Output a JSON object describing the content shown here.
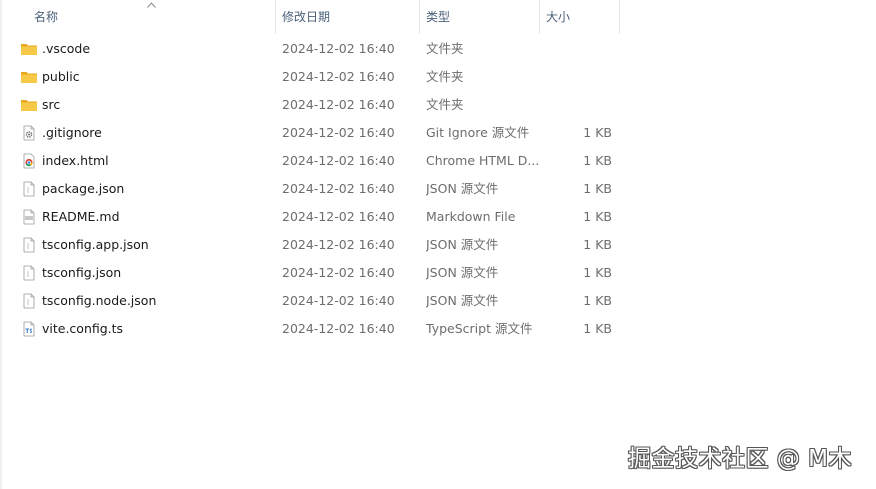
{
  "columns": {
    "name": "名称",
    "date": "修改日期",
    "type": "类型",
    "size": "大小"
  },
  "files": [
    {
      "name": ".vscode",
      "date": "2024-12-02 16:40",
      "type": "文件夹",
      "size": "",
      "icon": "folder-icon"
    },
    {
      "name": "public",
      "date": "2024-12-02 16:40",
      "type": "文件夹",
      "size": "",
      "icon": "folder-icon"
    },
    {
      "name": "src",
      "date": "2024-12-02 16:40",
      "type": "文件夹",
      "size": "",
      "icon": "folder-icon"
    },
    {
      "name": ".gitignore",
      "date": "2024-12-02 16:40",
      "type": "Git Ignore 源文件",
      "size": "1 KB",
      "icon": "gear-file-icon"
    },
    {
      "name": "index.html",
      "date": "2024-12-02 16:40",
      "type": "Chrome HTML D...",
      "size": "1 KB",
      "icon": "chrome-file-icon"
    },
    {
      "name": "package.json",
      "date": "2024-12-02 16:40",
      "type": "JSON 源文件",
      "size": "1 KB",
      "icon": "text-file-icon"
    },
    {
      "name": "README.md",
      "date": "2024-12-02 16:40",
      "type": "Markdown File",
      "size": "1 KB",
      "icon": "markdown-file-icon"
    },
    {
      "name": "tsconfig.app.json",
      "date": "2024-12-02 16:40",
      "type": "JSON 源文件",
      "size": "1 KB",
      "icon": "text-file-icon"
    },
    {
      "name": "tsconfig.json",
      "date": "2024-12-02 16:40",
      "type": "JSON 源文件",
      "size": "1 KB",
      "icon": "text-file-icon"
    },
    {
      "name": "tsconfig.node.json",
      "date": "2024-12-02 16:40",
      "type": "JSON 源文件",
      "size": "1 KB",
      "icon": "text-file-icon"
    },
    {
      "name": "vite.config.ts",
      "date": "2024-12-02 16:40",
      "type": "TypeScript 源文件",
      "size": "1 KB",
      "icon": "typescript-file-icon"
    }
  ],
  "watermark": "掘金技术社区 @ M木",
  "colors": {
    "header_text": "#4c607a",
    "folder": "#f5c342",
    "secondary_text": "#6d6d6d"
  }
}
